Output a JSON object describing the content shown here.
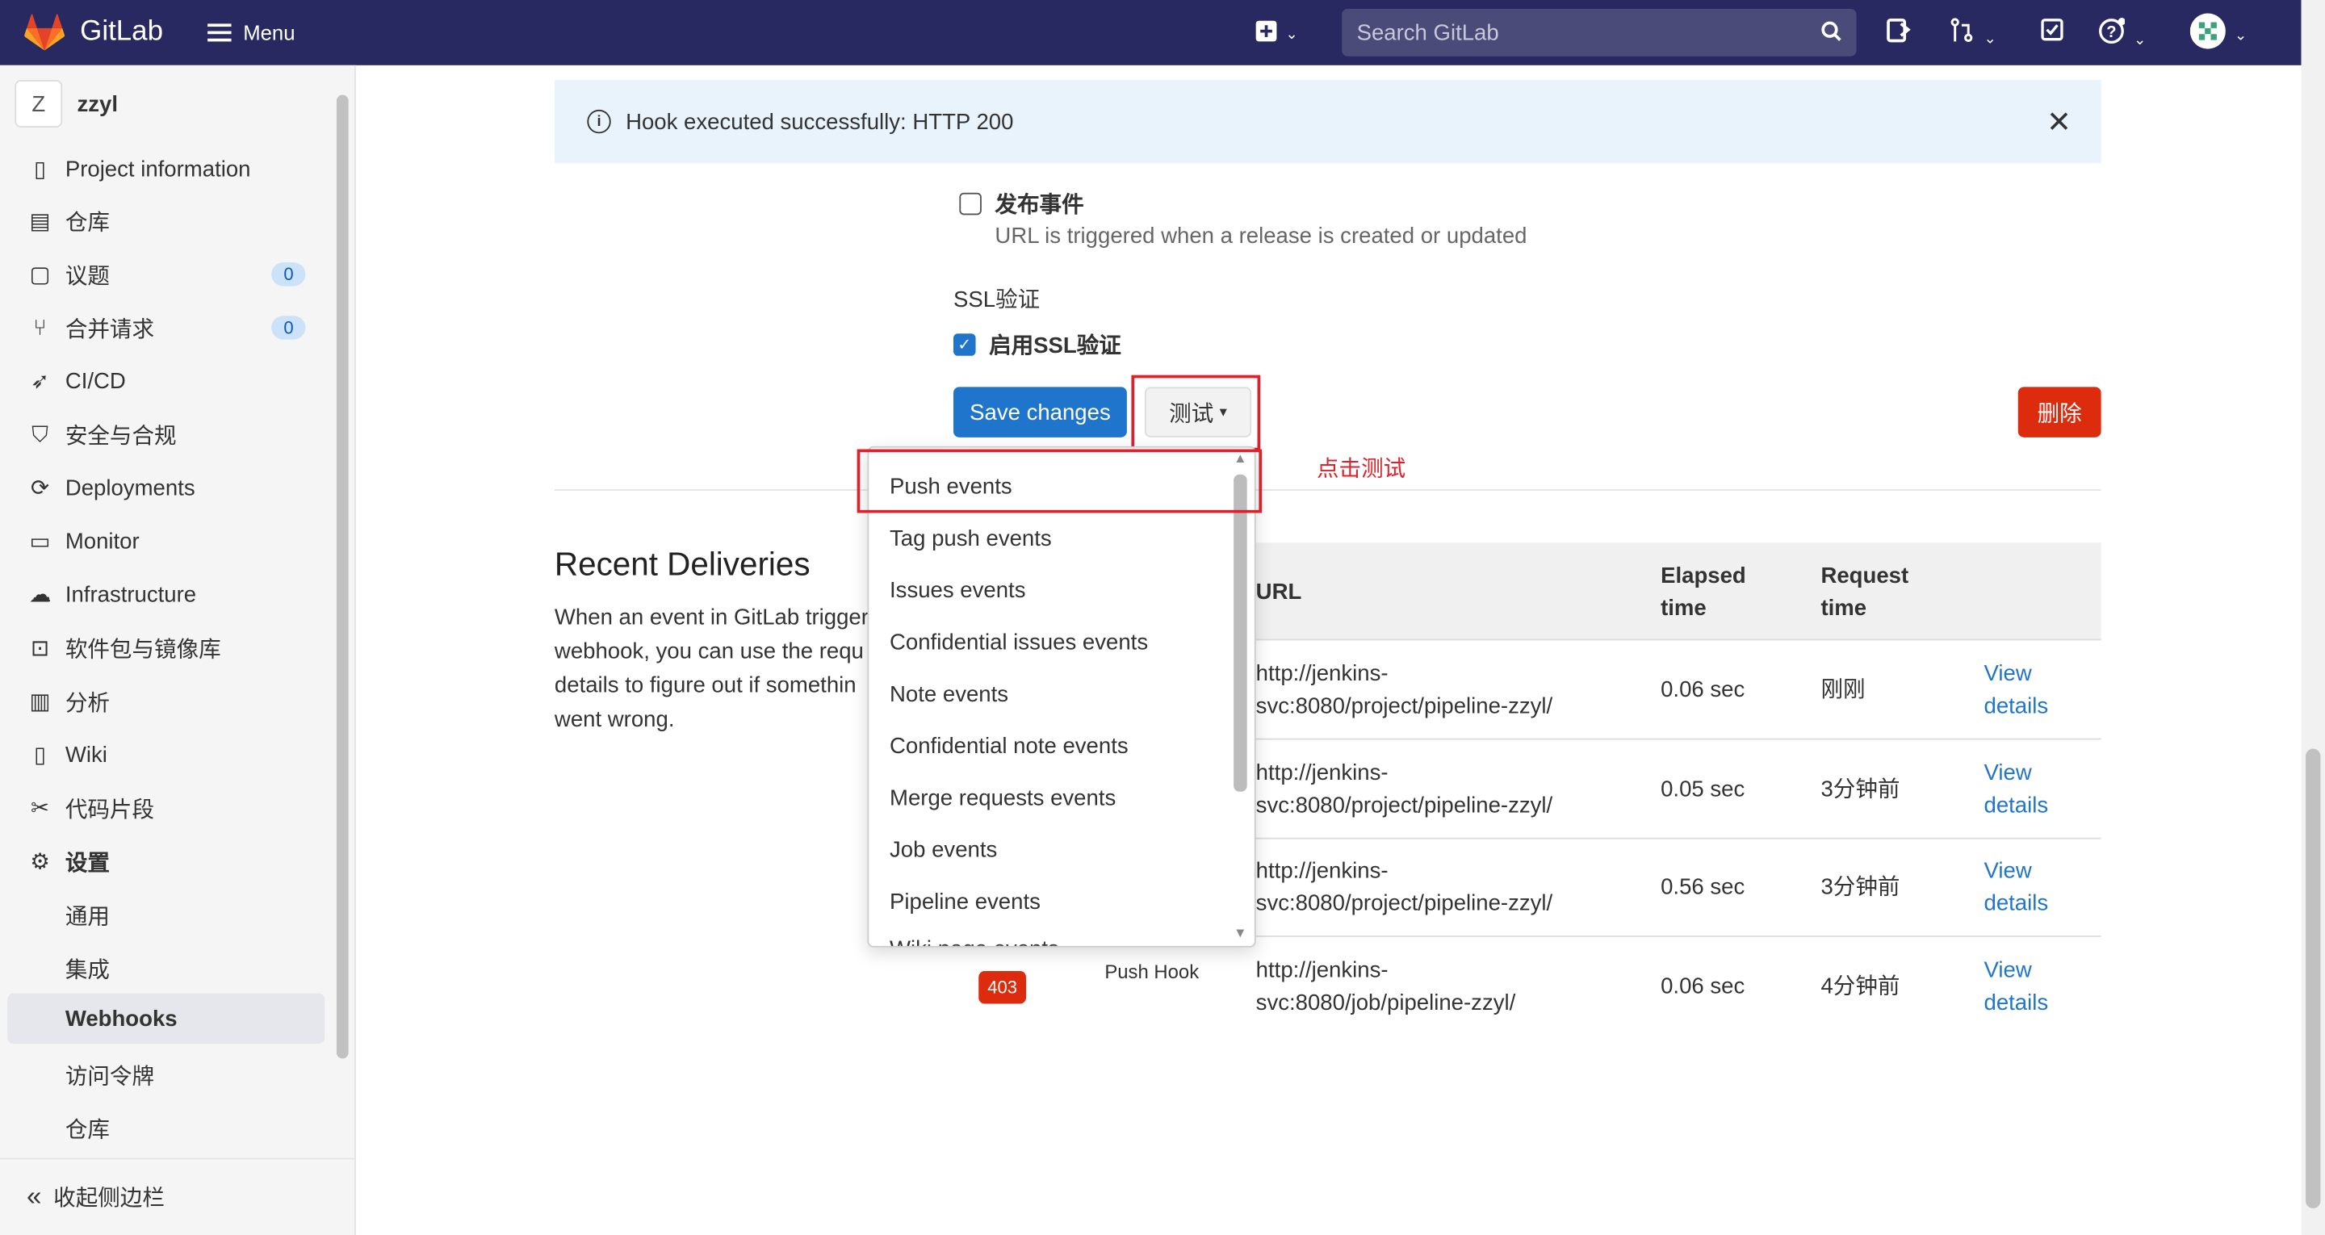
{
  "topbar": {
    "brand": "GitLab",
    "menu_label": "Menu",
    "search_placeholder": "Search GitLab"
  },
  "sidebar": {
    "project_initial": "Z",
    "project_name": "zzyl",
    "items": [
      {
        "label": "Project information",
        "icon": "info-icon"
      },
      {
        "label": "仓库",
        "icon": "doc-icon"
      },
      {
        "label": "议题",
        "icon": "issues-icon",
        "count": "0"
      },
      {
        "label": "合并请求",
        "icon": "merge-request-icon",
        "count": "0"
      },
      {
        "label": "CI/CD",
        "icon": "rocket-icon"
      },
      {
        "label": "安全与合规",
        "icon": "shield-icon"
      },
      {
        "label": "Deployments",
        "icon": "deployments-icon"
      },
      {
        "label": "Monitor",
        "icon": "monitor-icon"
      },
      {
        "label": "Infrastructure",
        "icon": "cloud-icon"
      },
      {
        "label": "软件包与镜像库",
        "icon": "package-icon"
      },
      {
        "label": "分析",
        "icon": "chart-icon"
      },
      {
        "label": "Wiki",
        "icon": "book-icon"
      },
      {
        "label": "代码片段",
        "icon": "scissors-icon"
      },
      {
        "label": "设置",
        "icon": "gear-icon"
      }
    ],
    "sub_items": [
      "通用",
      "集成",
      "Webhooks",
      "访问令牌",
      "仓库"
    ],
    "collapse_label": "收起侧边栏"
  },
  "alert": {
    "message": "Hook executed successfully: HTTP 200"
  },
  "form": {
    "release_label": "发布事件",
    "release_help": "URL is triggered when a release is created or updated",
    "ssl_heading": "SSL验证",
    "ssl_label": "启用SSL验证",
    "save_label": "Save changes",
    "test_label": "测试",
    "delete_label": "删除",
    "annotation": "点击测试"
  },
  "dropdown": {
    "items": [
      "Push events",
      "Tag push events",
      "Issues events",
      "Confidential issues events",
      "Note events",
      "Confidential note events",
      "Merge requests events",
      "Job events",
      "Pipeline events",
      "Wiki page events"
    ]
  },
  "deliveries": {
    "title": "Recent Deliveries",
    "description": "When an event in GitLab trigger webhook, you can use the requ details to figure out if somethin went wrong.",
    "headers": {
      "url": "URL",
      "elapsed": "Elapsed time",
      "request": "Request time"
    },
    "rows": [
      {
        "url": "http://jenkins-svc:8080/project/pipeline-zzyl/",
        "elapsed": "0.06 sec",
        "request": "刚刚",
        "link": "View details"
      },
      {
        "url": "http://jenkins-svc:8080/project/pipeline-zzyl/",
        "elapsed": "0.05 sec",
        "request": "3分钟前",
        "link": "View details"
      },
      {
        "url": "http://jenkins-svc:8080/project/pipeline-zzyl/",
        "elapsed": "0.56 sec",
        "request": "3分钟前",
        "link": "View details"
      },
      {
        "url": "http://jenkins-svc:8080/job/pipeline-zzyl/",
        "elapsed": "0.06 sec",
        "request": "4分钟前",
        "link": "View details",
        "status": "403",
        "trigger": "Push Hook"
      }
    ]
  }
}
